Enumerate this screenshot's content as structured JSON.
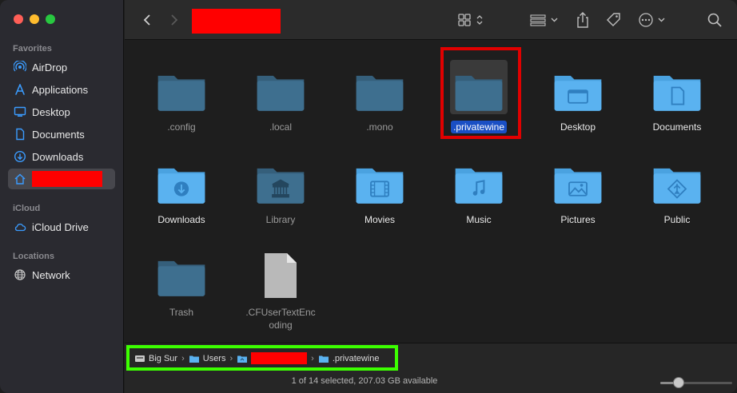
{
  "sidebar": {
    "sections": [
      {
        "label": "Favorites"
      },
      {
        "label": "iCloud"
      },
      {
        "label": "Locations"
      }
    ],
    "favorites": [
      {
        "label": "AirDrop",
        "icon": "airdrop-icon"
      },
      {
        "label": "Applications",
        "icon": "applications-icon"
      },
      {
        "label": "Desktop",
        "icon": "desktop-icon"
      },
      {
        "label": "Documents",
        "icon": "document-icon"
      },
      {
        "label": "Downloads",
        "icon": "download-icon"
      },
      {
        "label": "",
        "icon": "home-icon",
        "redacted": true,
        "selected": true
      }
    ],
    "icloud": [
      {
        "label": "iCloud Drive",
        "icon": "cloud-icon"
      }
    ],
    "locations": [
      {
        "label": "Network",
        "icon": "network-icon"
      }
    ]
  },
  "toolbar": {
    "title_redacted": true
  },
  "files": [
    {
      "name": ".config",
      "kind": "folder",
      "hidden": true
    },
    {
      "name": ".local",
      "kind": "folder",
      "hidden": true
    },
    {
      "name": ".mono",
      "kind": "folder",
      "hidden": true
    },
    {
      "name": ".privatewine",
      "kind": "folder",
      "hidden": true,
      "selected": true
    },
    {
      "name": "Desktop",
      "kind": "folder-desktop"
    },
    {
      "name": "Documents",
      "kind": "folder-documents"
    },
    {
      "name": "Downloads",
      "kind": "folder-downloads"
    },
    {
      "name": "Library",
      "kind": "folder-library",
      "hidden": true
    },
    {
      "name": "Movies",
      "kind": "folder-movies"
    },
    {
      "name": "Music",
      "kind": "folder-music"
    },
    {
      "name": "Pictures",
      "kind": "folder-pictures"
    },
    {
      "name": "Public",
      "kind": "folder-public"
    },
    {
      "name": "Trash",
      "kind": "folder",
      "hidden": true
    },
    {
      "name": ".CFUserTextEncoding",
      "kind": "file",
      "hidden": true
    }
  ],
  "pathbar": {
    "crumbs": [
      {
        "label": "Big Sur",
        "icon": "disk-icon"
      },
      {
        "label": "Users",
        "icon": "folder-icon"
      },
      {
        "label": "",
        "icon": "home-folder-icon",
        "redacted": true
      },
      {
        "label": ".privatewine",
        "icon": "folder-icon"
      }
    ]
  },
  "status": {
    "text": "1 of 14 selected, 207.03 GB available"
  },
  "zoom_slider": {
    "value": 0.25
  },
  "colors": {
    "folder_blue": "#5ab2f0",
    "folder_hidden": "#3e6f8f",
    "selection_blue": "#1a4fc4",
    "red_highlight": "#e10000",
    "green_highlight": "#3cff00"
  }
}
